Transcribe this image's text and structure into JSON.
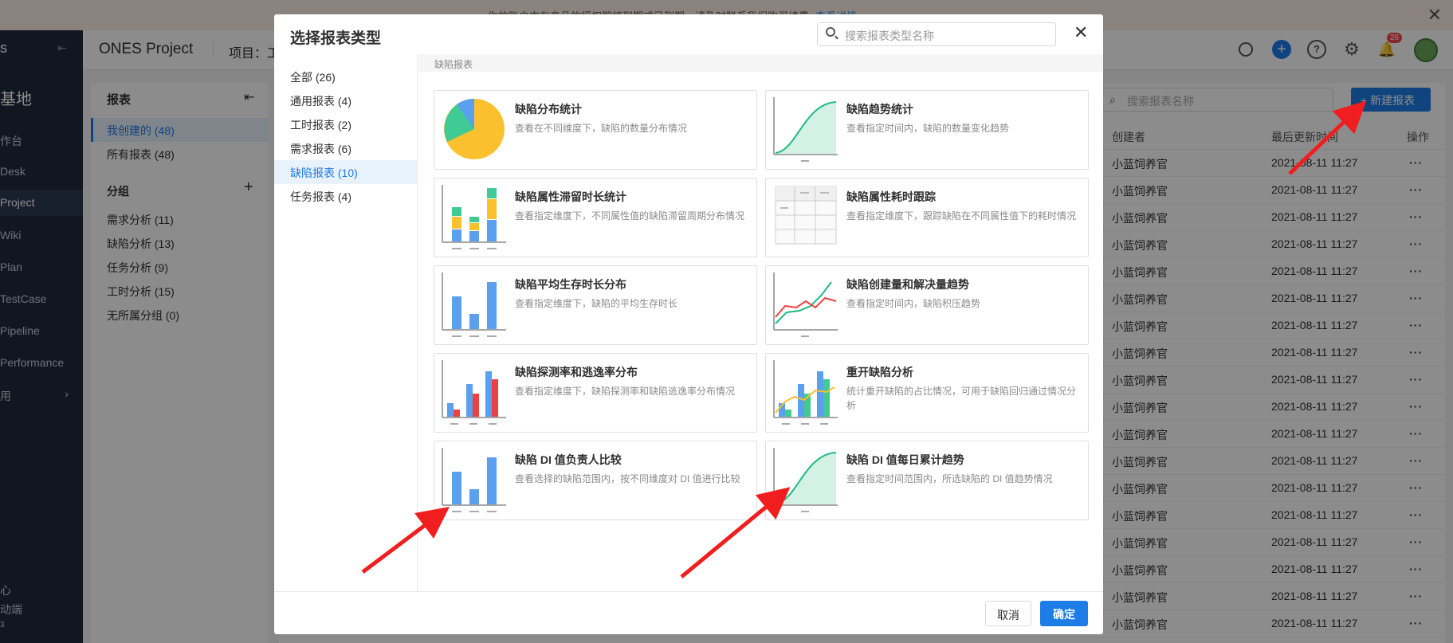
{
  "banner": {
    "message": "你的账户中有产品的授权即将到期或已到期，请及时联系我们购买续费",
    "link": "查看详情",
    "close": "✕"
  },
  "nav": {
    "logo": "s",
    "brand": "基地",
    "items": [
      "作台",
      "Desk",
      "Project",
      "Wiki",
      "Plan",
      "TestCase",
      "Pipeline",
      "Performance",
      "用"
    ],
    "bottom": [
      "心",
      "动端",
      "3"
    ]
  },
  "topbar": {
    "project": "ONES Project",
    "crumb": "项目：工",
    "badge": "26"
  },
  "left_panel": {
    "title": "报表",
    "items": [
      "我创建的 (48)",
      "所有报表 (48)"
    ],
    "group_title": "分组",
    "groups": [
      "需求分析 (11)",
      "缺陷分析 (13)",
      "任务分析 (9)",
      "工时分析 (15)",
      "无所属分组 (0)"
    ]
  },
  "main_panel": {
    "search_placeholder": "搜索报表名称",
    "new_button": "+ 新建报表",
    "columns": {
      "creator": "创建者",
      "updated": "最后更新时间",
      "actions": "操作"
    },
    "rows": [
      {
        "creator": "小蓝饲养官",
        "updated": "2021-08-11 11:27"
      },
      {
        "creator": "小蓝饲养官",
        "updated": "2021-08-11 11:27"
      },
      {
        "creator": "小蓝饲养官",
        "updated": "2021-08-11 11:27"
      },
      {
        "creator": "小蓝饲养官",
        "updated": "2021-08-11 11:27"
      },
      {
        "creator": "小蓝饲养官",
        "updated": "2021-08-11 11:27"
      },
      {
        "creator": "小蓝饲养官",
        "updated": "2021-08-11 11:27"
      },
      {
        "creator": "小蓝饲养官",
        "updated": "2021-08-11 11:27"
      },
      {
        "creator": "小蓝饲养官",
        "updated": "2021-08-11 11:27"
      },
      {
        "creator": "小蓝饲养官",
        "updated": "2021-08-11 11:27"
      },
      {
        "creator": "小蓝饲养官",
        "updated": "2021-08-11 11:27"
      },
      {
        "creator": "小蓝饲养官",
        "updated": "2021-08-11 11:27"
      },
      {
        "creator": "小蓝饲养官",
        "updated": "2021-08-11 11:27"
      },
      {
        "creator": "小蓝饲养官",
        "updated": "2021-08-11 11:27"
      },
      {
        "creator": "小蓝饲养官",
        "updated": "2021-08-11 11:27"
      },
      {
        "creator": "小蓝饲养官",
        "updated": "2021-08-11 11:27"
      },
      {
        "creator": "小蓝饲养官",
        "updated": "2021-08-11 11:27"
      },
      {
        "creator": "小蓝饲养官",
        "updated": "2021-08-11 11:27"
      },
      {
        "creator": "小蓝饲养官",
        "updated": "2021-08-11 11:27"
      }
    ]
  },
  "modal": {
    "title": "选择报表类型",
    "search_placeholder": "搜索报表类型名称",
    "close": "✕",
    "categories": [
      {
        "label": "全部 (26)",
        "active": false
      },
      {
        "label": "通用报表 (4)",
        "active": false
      },
      {
        "label": "工时报表 (2)",
        "active": false
      },
      {
        "label": "需求报表 (6)",
        "active": false
      },
      {
        "label": "缺陷报表 (10)",
        "active": true
      },
      {
        "label": "任务报表 (4)",
        "active": false
      }
    ],
    "section": "缺陷报表",
    "cards": [
      {
        "title": "缺陷分布统计",
        "desc": "查看在不同维度下，缺陷的数量分布情况",
        "thumb": "pie-chart-icon"
      },
      {
        "title": "缺陷趋势统计",
        "desc": "查看指定时间内，缺陷的数量变化趋势",
        "thumb": "area-trend-icon"
      },
      {
        "title": "缺陷属性滞留时长统计",
        "desc": "查看指定维度下，不同属性值的缺陷滞留周期分布情况",
        "thumb": "stacked-bar-icon"
      },
      {
        "title": "缺陷属性耗时跟踪",
        "desc": "查看指定维度下，跟踪缺陷在不同属性值下的耗时情况",
        "thumb": "table-icon"
      },
      {
        "title": "缺陷平均生存时长分布",
        "desc": "查看指定维度下，缺陷的平均生存时长",
        "thumb": "bar-chart-icon"
      },
      {
        "title": "缺陷创建量和解决量趋势",
        "desc": "查看指定时间内，缺陷积压趋势",
        "thumb": "dual-line-icon"
      },
      {
        "title": "缺陷探测率和逃逸率分布",
        "desc": "查看指定维度下，缺陷探测率和缺陷逃逸率分布情况",
        "thumb": "grouped-bar-icon"
      },
      {
        "title": "重开缺陷分析",
        "desc": "统计重开缺陷的占比情况，可用于缺陷回归通过情况分析",
        "thumb": "combo-chart-icon"
      },
      {
        "title": "缺陷 DI 值负责人比较",
        "desc": "查看选择的缺陷范围内，按不同维度对 DI 值进行比较",
        "thumb": "bar-chart-icon"
      },
      {
        "title": "缺陷 DI 值每日累计趋势",
        "desc": "查看指定时间范围内，所选缺陷的 DI 值趋势情况",
        "thumb": "area-trend-icon"
      }
    ],
    "cancel": "取消",
    "ok": "确定"
  },
  "colors": {
    "primary": "#1d7ce6",
    "annotation": "#f01e1e",
    "green": "#1fba85",
    "yellow": "#fbc02d",
    "red": "#f04141"
  }
}
